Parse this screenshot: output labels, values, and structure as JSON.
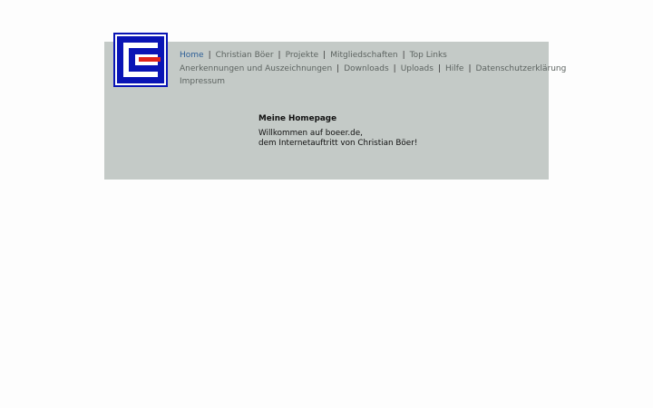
{
  "logo": {
    "name": "cb-logo-icon",
    "colors": {
      "blue": "#0a14b5",
      "red": "#e0241b",
      "white": "#ffffff"
    }
  },
  "panel": {
    "background": "#c4cac7"
  },
  "nav": {
    "items": [
      {
        "label": "Home",
        "active": true
      },
      {
        "label": "Christian Böer"
      },
      {
        "label": "Projekte"
      },
      {
        "label": "Mitgliedschaften"
      },
      {
        "label": "Top Links"
      },
      {
        "label": "Anerkennungen und Auszeichnungen"
      },
      {
        "label": "Downloads"
      },
      {
        "label": "Uploads"
      },
      {
        "label": "Hilfe"
      },
      {
        "label": "Datenschutzerklärung"
      },
      {
        "label": "Impressum"
      }
    ],
    "separator": "|"
  },
  "content": {
    "heading": "Meine Homepage",
    "line1": "Willkommen auf boeer.de,",
    "line2": "dem Internetauftritt von Christian Böer!"
  }
}
